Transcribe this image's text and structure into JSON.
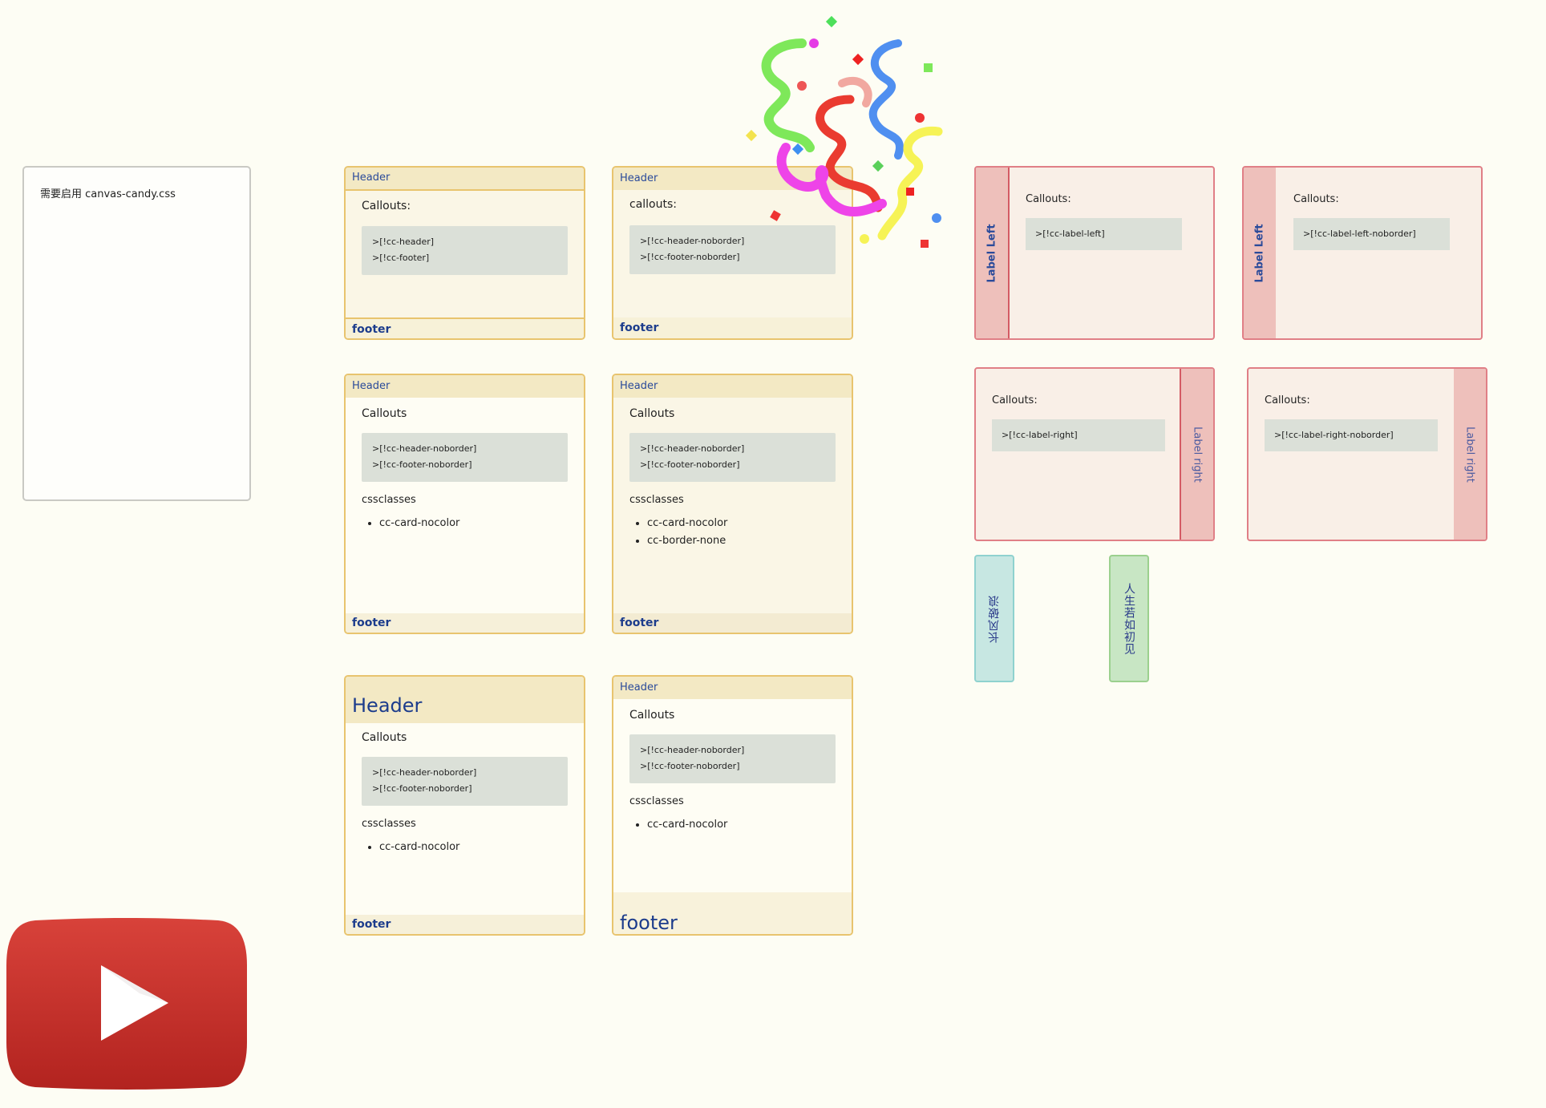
{
  "note": {
    "text": "需要启用 canvas-candy.css"
  },
  "card1": {
    "header": "Header",
    "title": "Callouts:",
    "code": [
      ">[!cc-header]",
      ">[!cc-footer]"
    ],
    "footer": "footer"
  },
  "card2": {
    "header": "Header",
    "title": "callouts:",
    "code": [
      ">[!cc-header-noborder]",
      ">[!cc-footer-noborder]"
    ],
    "footer": "footer"
  },
  "card3": {
    "header": "Header",
    "title": "Callouts",
    "code": [
      ">[!cc-header-noborder]",
      ">[!cc-footer-noborder]"
    ],
    "subtitle": "cssclasses",
    "list": [
      "cc-card-nocolor"
    ],
    "footer": "footer"
  },
  "card4": {
    "header": "Header",
    "title": "Callouts",
    "code": [
      ">[!cc-header-noborder]",
      ">[!cc-footer-noborder]"
    ],
    "subtitle": "cssclasses",
    "list": [
      "cc-card-nocolor",
      "cc-border-none"
    ],
    "footer": "footer"
  },
  "card5": {
    "header": "Header",
    "title": "Callouts",
    "code": [
      ">[!cc-header-noborder]",
      ">[!cc-footer-noborder]"
    ],
    "subtitle": "cssclasses",
    "list": [
      "cc-card-nocolor"
    ],
    "footer": "footer"
  },
  "card6": {
    "header": "Header",
    "title": "Callouts",
    "code": [
      ">[!cc-header-noborder]",
      ">[!cc-footer-noborder]"
    ],
    "subtitle": "cssclasses",
    "list": [
      "cc-card-nocolor"
    ],
    "footer": "footer"
  },
  "label_left": {
    "label": "Label Left",
    "title": "Callouts:",
    "code": ">[!cc-label-left]"
  },
  "label_left_noborder": {
    "label": "Label Left",
    "title": "Callouts:",
    "code": ">[!cc-label-left-noborder]"
  },
  "label_right": {
    "label": "Label right",
    "title": "Callouts:",
    "code": ">[!cc-label-right]"
  },
  "label_right_noborder": {
    "label": "Label right",
    "title": "Callouts:",
    "code": ">[!cc-label-right-noborder]"
  },
  "strip_teal": {
    "text": "长风破浪"
  },
  "strip_green": {
    "text": "人生若如初见"
  },
  "icons": {
    "confetti": "party-popper-streamers",
    "youtube": "youtube-play-logo"
  },
  "colors": {
    "background": "#fdfdf4",
    "card_border": "#e8c46e",
    "label_pink": "#eec0bb",
    "link_blue": "#2a4a9a",
    "youtube_red": "#c9302c"
  }
}
